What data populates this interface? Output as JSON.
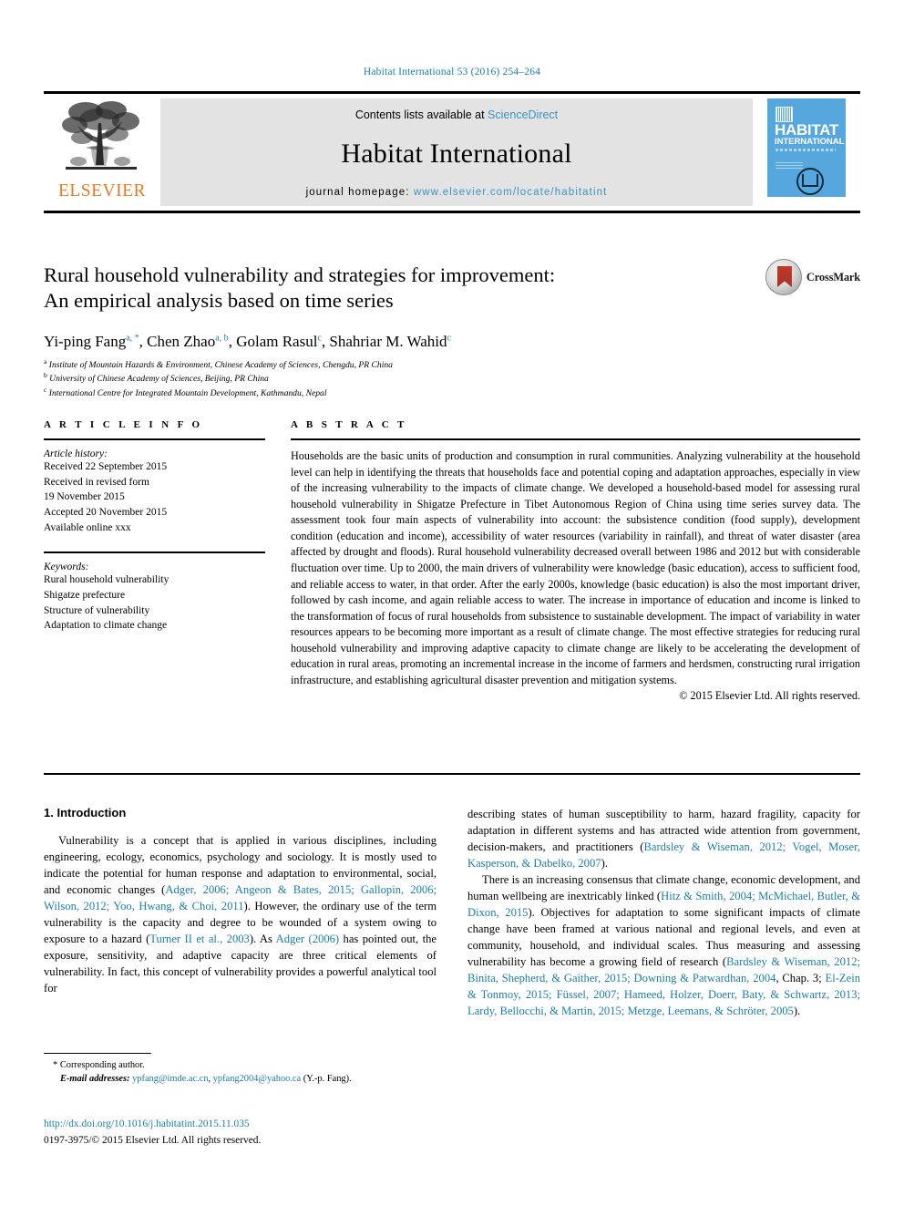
{
  "running_head": "Habitat International 53 (2016) 254–264",
  "masthead": {
    "publisher_name": "ELSEVIER",
    "publisher_logo_icon": "elsevier-tree-icon",
    "contents_prefix": "Contents lists available at ",
    "contents_link": "ScienceDirect",
    "journal_name": "Habitat International",
    "homepage_prefix": "journal homepage: ",
    "homepage_url": "www.elsevier.com/locate/habitatint",
    "cover": {
      "title_line1": "HABITAT",
      "title_line2": "INTERNATIONAL",
      "barcode_icon": "barcode-icon",
      "emblem_icon": "habitat-emblem-icon"
    }
  },
  "article": {
    "title_line1": "Rural household vulnerability and strategies for improvement:",
    "title_line2": "An empirical analysis based on time series",
    "authors": [
      {
        "name": "Yi-ping Fang",
        "marks": "a, *"
      },
      {
        "name": "Chen Zhao",
        "marks": "a, b"
      },
      {
        "name": "Golam Rasul",
        "marks": "c"
      },
      {
        "name": "Shahriar M. Wahid",
        "marks": "c"
      }
    ],
    "affiliations": [
      {
        "mark": "a",
        "text": "Institute of Mountain Hazards & Environment, Chinese Academy of Sciences, Chengdu, PR China"
      },
      {
        "mark": "b",
        "text": "University of Chinese Academy of Sciences, Beijing, PR China"
      },
      {
        "mark": "c",
        "text": "International Centre for Integrated Mountain Development, Kathmandu, Nepal"
      }
    ]
  },
  "crossmark": {
    "label": "CrossMark",
    "icon": "crossmark-badge-icon"
  },
  "article_info": {
    "heading": "A R T I C L E   I N F O",
    "history_title": "Article history:",
    "history": [
      "Received 22 September 2015",
      "Received in revised form",
      "19 November 2015",
      "Accepted 20 November 2015",
      "Available online xxx"
    ],
    "keywords_title": "Keywords:",
    "keywords": [
      "Rural household vulnerability",
      "Shigatze prefecture",
      "Structure of vulnerability",
      "Adaptation to climate change"
    ]
  },
  "abstract": {
    "heading": "A B S T R A C T",
    "text": "Households are the basic units of production and consumption in rural communities. Analyzing vulnerability at the household level can help in identifying the threats that households face and potential coping and adaptation approaches, especially in view of the increasing vulnerability to the impacts of climate change. We developed a household-based model for assessing rural household vulnerability in Shigatze Prefecture in Tibet Autonomous Region of China using time series survey data. The assessment took four main aspects of vulnerability into account: the subsistence condition (food supply), development condition (education and income), accessibility of water resources (variability in rainfall), and threat of water disaster (area affected by drought and floods). Rural household vulnerability decreased overall between 1986 and 2012 but with considerable fluctuation over time. Up to 2000, the main drivers of vulnerability were knowledge (basic education), access to sufficient food, and reliable access to water, in that order. After the early 2000s, knowledge (basic education) is also the most important driver, followed by cash income, and again reliable access to water. The increase in importance of education and income is linked to the transformation of focus of rural households from subsistence to sustainable development. The impact of variability in water resources appears to be becoming more important as a result of climate change. The most effective strategies for reducing rural household vulnerability and improving adaptive capacity to climate change are likely to be accelerating the development of education in rural areas, promoting an incremental increase in the income of farmers and herdsmen, constructing rural irrigation infrastructure, and establishing agricultural disaster prevention and mitigation systems.",
    "copyright": "© 2015 Elsevier Ltd. All rights reserved."
  },
  "introduction": {
    "section_number_title": "1. Introduction",
    "left_paragraph_1_a": "Vulnerability is a concept that is applied in various disciplines, including engineering, ecology, economics, psychology and sociology. It is mostly used to indicate the potential for human response and adaptation to environmental, social, and economic changes (",
    "left_cite_1": "Adger, 2006; Angeon & Bates, 2015; Gallopin, 2006; Wilson, 2012; Yoo, Hwang, & Choi, 2011",
    "left_paragraph_1_b": "). However, the ordinary use of the term vulnerability is the capacity and degree to be wounded of a system owing to exposure to a hazard (",
    "left_cite_2": "Turner II et al., 2003",
    "left_paragraph_1_c": "). As ",
    "left_cite_3": "Adger (2006)",
    "left_paragraph_1_d": " has pointed out, the exposure, sensitivity, and adaptive capacity are three critical elements of vulnerability. In fact, this concept of vulnerability provides a powerful analytical tool for",
    "right_paragraph_1_a": "describing states of human susceptibility to harm, hazard fragility, capacity for adaptation in different systems and has attracted wide attention from government, decision-makers, and practitioners (",
    "right_cite_1": "Bardsley & Wiseman, 2012; Vogel, Moser, Kasperson, & Dabelko, 2007",
    "right_paragraph_1_b": ").",
    "right_paragraph_2_a": "There is an increasing consensus that climate change, economic development, and human wellbeing are inextricably linked (",
    "right_cite_2": "Hitz & Smith, 2004; McMichael, Butler, & Dixon, 2015",
    "right_paragraph_2_b": "). Objectives for adaptation to some significant impacts of climate change have been framed at various national and regional levels, and even at community, household, and individual scales. Thus measuring and assessing vulnerability has become a growing field of research (",
    "right_cite_3": "Bardsley & Wiseman, 2012; Binita, Shepherd, & Gaither, 2015; Downing & Patwardhan, 2004",
    "right_paragraph_2_c": ", Chap. 3; ",
    "right_cite_4": "El-Zein & Tonmoy, 2015; Füssel, 2007; Hameed, Holzer, Doerr, Baty, & Schwartz, 2013; Lardy, Bellocchi, & Martin, 2015; Metzge, Leemans, & Schröter, 2005",
    "right_paragraph_2_d": ")."
  },
  "footer": {
    "corresponding_marker": "*",
    "corresponding_label": "Corresponding author.",
    "email_label": "E-mail addresses:",
    "email_1": "ypfang@imde.ac.cn",
    "email_sep": ", ",
    "email_2": "ypfang2004@yahoo.ca",
    "email_suffix": " (Y.-p. Fang).",
    "doi": "http://dx.doi.org/10.1016/j.habitatint.2015.11.035",
    "issn_line": "0197-3975/© 2015 Elsevier Ltd. All rights reserved."
  },
  "colors": {
    "link_blue": "#1a7fa8",
    "sciencedirect_blue": "#3a93c4",
    "elsevier_orange": "#E77B22",
    "cover_blue": "#55a7dd",
    "masthead_gray": "#e3e3e3"
  }
}
